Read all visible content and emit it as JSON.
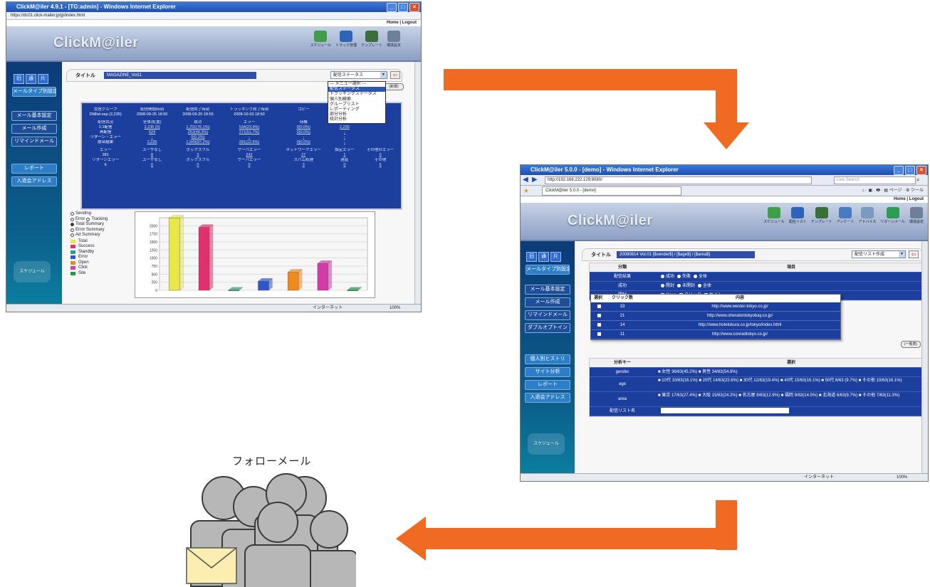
{
  "colors": {
    "arrow": "#f06a22",
    "panel_blue": "#1c3e9c",
    "sidebar_blue": "#0d3b78",
    "person_fill": "#b7b7b7",
    "envelope": "#fbeeb0"
  },
  "window1": {
    "title": "ClickM@iler 4.9.1 - [TG:admin] - Windows Internet Explorer",
    "address": "https://dc01.click-mailer.jp/jp/index.html",
    "header_links": "Home | Logout",
    "logo": "ClickM@iler",
    "toolbar": [
      {
        "label": "スケジュール",
        "icon": "schedule-icon",
        "color": "#3f9e4a"
      },
      {
        "label": "トラック管理",
        "icon": "track-icon",
        "color": "#2d64b8"
      },
      {
        "label": "テンプレート",
        "icon": "template-icon",
        "color": "#3a6e3a"
      },
      {
        "label": "環境設定",
        "icon": "settings-icon",
        "color": "#6d7f99"
      }
    ],
    "sidebar": {
      "squares": [
        "旧",
        "通",
        "片"
      ],
      "mail_type_label": "メールタイプ別設定",
      "menu": [
        "メール基本設定",
        "メール作成",
        "リマインドメール"
      ],
      "menu2": [
        "レポート",
        "入退会アドレス"
      ],
      "schedule_label": "スケジュール"
    },
    "title_label": "タイトル",
    "title_value": "MAGAZINE_Vol11",
    "select_value": "配信ステータス",
    "dropdown_items": [
      "--- メニュー選択 ---",
      "配信ステータス",
      "トラッキングステータス",
      "個人別検索",
      "グループリスト",
      "レポーティング",
      "部分分析",
      "統計分析"
    ],
    "side_button": "(新規)",
    "stats": {
      "header1": [
        "受信グループ",
        "配信開始時刻",
        "配信終了時刻",
        "トラッキング終了時刻",
        "コピー",
        "AS"
      ],
      "row1": [
        "DMlist-sep (2,235)",
        "2008-09-25 18:50",
        "2008-09-25 18:55",
        "2008-10-03 18:50",
        "",
        "ASA"
      ],
      "header2": [
        "配信状況",
        "全体(処置)",
        "成功",
        "エラー",
        "待機",
        "処理件数"
      ],
      "rows2": [
        [
          "1:1配信",
          "2,235 (0)",
          "1,701(76.1%)",
          "534(23.9%)",
          "0(0.0%)",
          "2,235"
        ],
        [
          "再配信",
          "524",
          "253(48.3%)",
          "271(51.7%)",
          "0(0.0%)",
          "-"
        ],
        [
          "リターン・エラー",
          "-",
          "0(0.3%)",
          "-",
          "-",
          "-"
        ],
        [
          "総合結果",
          "2,235",
          "1,949(87.2%)",
          "281(12.6%)",
          "0(0.0%)",
          "-"
        ]
      ],
      "header3": [
        "エラー",
        "ユーザなし",
        "ボックスフル",
        "サーバエラー",
        "ネットワークエラー",
        "設定エラー",
        "その他のエラー"
      ],
      "row3": [
        "281",
        "8",
        "3",
        "242",
        "27",
        "1",
        "0"
      ],
      "header4": [
        "リターンエラー",
        "ユーザなし",
        "ボックスフル",
        "サーバエラー",
        "スパム処理",
        "遅延",
        "その他"
      ],
      "row4": [
        "6",
        "0",
        "0",
        "0",
        "3",
        "0",
        "6"
      ]
    },
    "radio_options": [
      {
        "label": "Sending",
        "on": false
      },
      {
        "label": "Error",
        "on": false,
        "extra": "Tracking"
      },
      {
        "label": "Total Summary",
        "on": true
      },
      {
        "label": "Error Summary",
        "on": false
      },
      {
        "label": "Ad Summary",
        "on": false
      }
    ],
    "legend": [
      {
        "label": "Total",
        "color": "#e8e84a"
      },
      {
        "label": "Success",
        "color": "#e0306e"
      },
      {
        "label": "Standby",
        "color": "#2aa07a"
      },
      {
        "label": "Error",
        "color": "#2f56c4"
      },
      {
        "label": "Open",
        "color": "#f08a1c"
      },
      {
        "label": "Click",
        "color": "#d23ca6"
      },
      {
        "label": "Site",
        "color": "#1f9a4e"
      }
    ],
    "status_zone": "インターネット",
    "status_zoom": "100%"
  },
  "chart_data": {
    "type": "bar",
    "categories": [
      "Total",
      "Success",
      "Standby",
      "Error",
      "Open",
      "Click",
      "Site"
    ],
    "values": [
      2235,
      1950,
      5,
      281,
      560,
      830,
      5
    ],
    "y_ticks": [
      "2000",
      "1750",
      "1500",
      "1250",
      "1000",
      "750",
      "500",
      "250",
      "0"
    ],
    "ylim": [
      0,
      2250
    ],
    "title": "",
    "xlabel": "",
    "ylabel": ""
  },
  "window2": {
    "title": "ClickM@iler 5.0.0 - [demo] - Windows Internet Explorer",
    "address": "http://192.168.222.129:8080/",
    "search_placeholder": "Live Search",
    "tab_label": "ClickM@iler 5.0.0 - [demo]",
    "header_links": "Home | Logout",
    "logo": "ClickM@iler",
    "toolbar": [
      {
        "label": "スケジュール",
        "icon": "schedule-icon",
        "color": "#3f9e4a"
      },
      {
        "label": "配信リスト",
        "icon": "list-icon",
        "color": "#2d64b8"
      },
      {
        "label": "テンプレート",
        "icon": "template-icon",
        "color": "#3a6e3a"
      },
      {
        "label": "アンケート",
        "icon": "survey-icon",
        "color": "#4a7ac0"
      },
      {
        "label": "アドバイス",
        "icon": "advice-icon",
        "color": "#7a9ac0"
      },
      {
        "label": "リターンメール",
        "icon": "return-icon",
        "color": "#2e9c52"
      },
      {
        "label": "環境設定",
        "icon": "settings-icon",
        "color": "#6d7f99"
      }
    ],
    "sidebar": {
      "squares": [
        "旧",
        "通",
        "片"
      ],
      "mail_type_label": "メールタイプ別設定",
      "menu": [
        "メール基本設定",
        "メール作成",
        "リマインドメール",
        "ダブルオプトイン"
      ],
      "menu2": [
        "個人別ヒストリ",
        "サイト分析",
        "レポート",
        "入退会アドレス"
      ],
      "schedule_label": "スケジュール"
    },
    "title_label": "タイトル",
    "title_value": "20080814 Vol.01 [$sender$] / [$age$] / [$area$]",
    "select_value": "配信リスト作成",
    "form_headers": [
      "分類",
      "項目"
    ],
    "form_rows": [
      {
        "label": "配信結果",
        "options": [
          "成功",
          "失敗",
          "全体"
        ],
        "kind": "radio"
      },
      {
        "label": "成功",
        "options": [
          "開封",
          "未開封",
          "全体"
        ],
        "kind": "radio"
      },
      {
        "label": "開封",
        "options": [
          "Open",
          "クリック",
          "サイト"
        ],
        "kind": "check"
      }
    ],
    "popup_headers": [
      "選択",
      "クリック数",
      "内容"
    ],
    "popup_rows": [
      {
        "count": "33",
        "url": "http://www.wester-tokyo.co.jp/"
      },
      {
        "count": "21",
        "url": "http://www.sheratontokyobay.co.jp/"
      },
      {
        "count": "14",
        "url": "http://www.hotelokura.co.jp/tokyo/index.html"
      },
      {
        "count": "11",
        "url": "http://www.conradtokyo.co.jp/"
      }
    ],
    "popup_button": "(一覧表)",
    "form2_headers": [
      "分析キー",
      "選択"
    ],
    "form2_rows": [
      {
        "label": "gender",
        "text": "■ 女性 36/63(45.2%)   ■ 男性 34/63(54.8%)"
      },
      {
        "label": "age",
        "text": "■ 10代 10/63(16.1%)  ■ 20代 14/63(22.6%)  ■ 30代 12/63(19.4%)  ■ 40代 10/63(16.1%)  ■ 50代 6/63 (9.7%)  ■ その他 10/63(16.1%)"
      },
      {
        "label": "area",
        "text": "■ 東京 17/63(27.4%)  ■ 大阪 15/63(24.2%)  ■ 名古屋 8/63(12.9%)  ■ 福岡 9/63(14.5%)  ■ 北海道 6/63(9.7%)  ■ その他 7/63(11.3%)"
      },
      {
        "label": "配信リスト名",
        "text": ""
      }
    ],
    "status_zone": "インターネット",
    "status_zoom": "100%"
  },
  "caption": "フォローメール"
}
